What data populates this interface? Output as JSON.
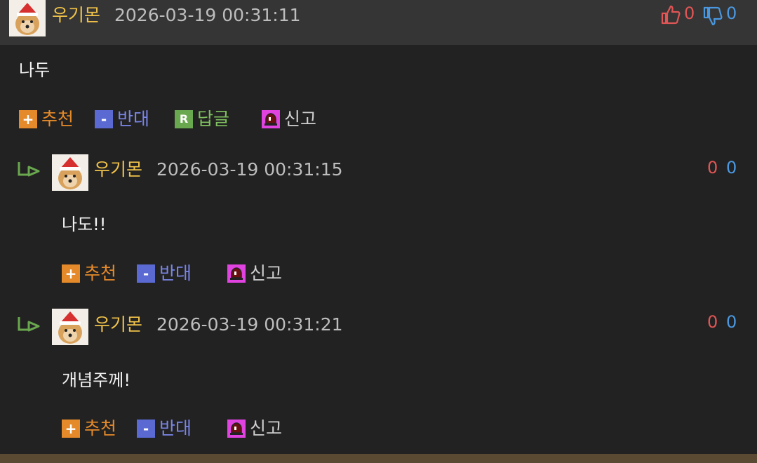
{
  "colors": {
    "background": "#222222",
    "header": "#353535",
    "name": "#f0c24a",
    "date": "#bdbdbd",
    "like": "#e05555",
    "dislike": "#4a98e0",
    "recommend": "#e58a2a",
    "oppose": "#5a6ad2",
    "reply": "#6aa84f",
    "report": "#e043e0"
  },
  "main_comment": {
    "author": "우기몬",
    "date": "2026-03-19 00:31:11",
    "likes": "0",
    "dislikes": "0",
    "text": "나두",
    "actions": {
      "recommend": "추천",
      "oppose": "반대",
      "reply": "답글",
      "report": "신고",
      "recommend_icon": "+",
      "oppose_icon": "-",
      "reply_icon": "R"
    }
  },
  "replies": [
    {
      "author": "우기몬",
      "date": "2026-03-19 00:31:15",
      "likes": "0",
      "dislikes": "0",
      "text": "나도!!",
      "actions": {
        "recommend": "추천",
        "oppose": "반대",
        "report": "신고",
        "recommend_icon": "+",
        "oppose_icon": "-"
      }
    },
    {
      "author": "우기몬",
      "date": "2026-03-19 00:31:21",
      "likes": "0",
      "dislikes": "0",
      "text": "개념주께!",
      "actions": {
        "recommend": "추천",
        "oppose": "반대",
        "report": "신고",
        "recommend_icon": "+",
        "oppose_icon": "-"
      }
    }
  ]
}
